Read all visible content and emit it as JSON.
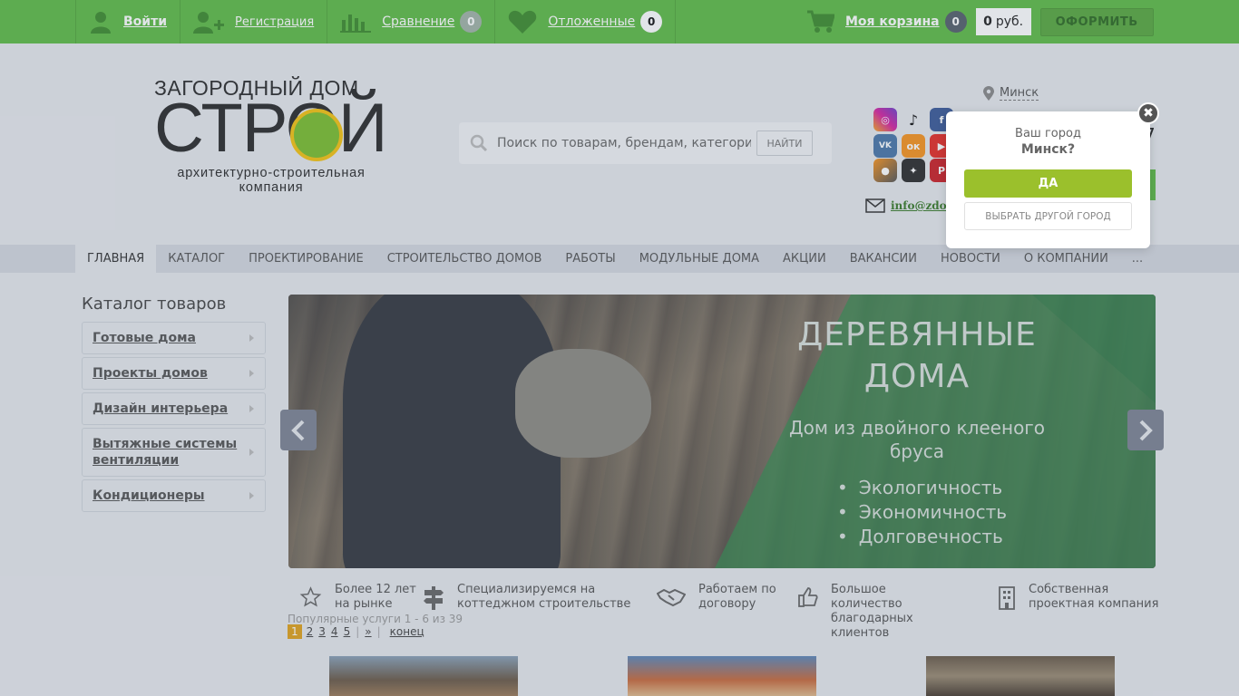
{
  "topbar": {
    "login": "Войти",
    "register": "Регистрация",
    "compare": "Сравнение",
    "compare_count": "0",
    "wishlist": "Отложенные",
    "wishlist_count": "0",
    "cart": "Моя корзина",
    "cart_count": "0",
    "cart_sum_value": "0",
    "cart_sum_currency": "руб.",
    "checkout": "ОФОРМИТЬ"
  },
  "logo": {
    "line1": "ЗАГОРОДНЫЙ ДОМ",
    "line2": "СТРОЙ",
    "tagline": "архитектурно-строительная компания"
  },
  "search": {
    "placeholder": "Поиск по товарам, брендам, категориям",
    "button": "НАЙТИ"
  },
  "header": {
    "city": "Минск",
    "phone_fragment": "7",
    "email": "info@zdom."
  },
  "socials": [
    "instagram-icon",
    "tiktok-icon",
    "facebook-icon",
    "vk-icon",
    "odnoklassniki-icon",
    "youtube-icon",
    "lifeguard-icon",
    "yandex-zen-icon",
    "pinterest-icon"
  ],
  "nav": [
    "ГЛАВНАЯ",
    "КАТАЛОГ",
    "ПРОЕКТИРОВАНИЕ",
    "СТРОИТЕЛЬСТВО ДОМОВ",
    "РАБОТЫ",
    "МОДУЛЬНЫЕ ДОМА",
    "АКЦИИ",
    "ВАКАНСИИ",
    "НОВОСТИ",
    "О КОМПАНИИ",
    "..."
  ],
  "catalog": {
    "title": "Каталог товаров",
    "items": [
      "Готовые дома",
      "Проекты домов",
      "Дизайн интерьера",
      "Вытяжные системы вентиляции",
      "Кондиционеры"
    ]
  },
  "slider": {
    "title": "ДЕРЕВЯННЫЕ ДОМА",
    "subtitle": "Дом из двойного клееного бруса",
    "bullets": [
      "Экологичность",
      "Экономичность",
      "Долговечность"
    ]
  },
  "features": [
    {
      "icon": "star-icon",
      "text": "Более 12 лет на рынке"
    },
    {
      "icon": "signpost-icon",
      "text": "Специализируемся на коттеджном строительстве"
    },
    {
      "icon": "handshake-icon",
      "text": "Работаем по договору"
    },
    {
      "icon": "thumbs-up-icon",
      "text": "Большое количество благодарных клиентов"
    },
    {
      "icon": "building-icon",
      "text": "Собственная проектная компания"
    }
  ],
  "popular": "Популярные услуги 1 - 6 из 39",
  "pager": {
    "current": "1",
    "pages": [
      "2",
      "3",
      "4",
      "5"
    ],
    "next": "»",
    "last": "конец"
  },
  "popup": {
    "question": "Ваш город",
    "city_question": "Минск?",
    "yes": "ДА",
    "other": "ВЫБРАТЬ ДРУГОЙ ГОРОД"
  },
  "colors": {
    "topbar_green": "#5fbb46",
    "accent_yellow_green": "#9bc02c",
    "pager_current": "#e0a21c"
  }
}
